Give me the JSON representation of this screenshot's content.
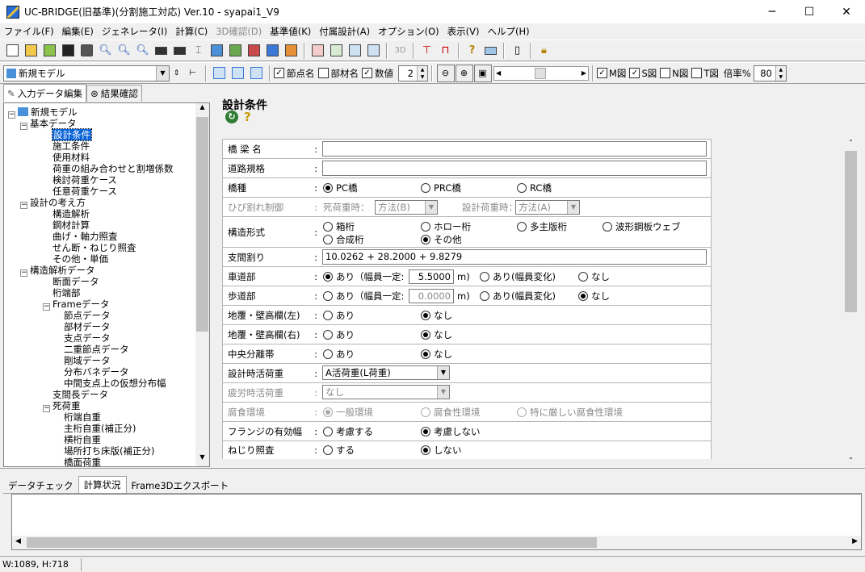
{
  "window": {
    "title": "UC-BRIDGE(旧基準)(分割施工対応) Ver.10 - syapai1_V9",
    "minimize": "─",
    "maximize": "☐",
    "close": "✕"
  },
  "menu": [
    {
      "label": "ファイル(F)"
    },
    {
      "label": "編集(E)"
    },
    {
      "label": "ジェネレータ(I)"
    },
    {
      "label": "計算(C)"
    },
    {
      "label": "3D確認(D)",
      "disabled": true
    },
    {
      "label": "基準値(K)"
    },
    {
      "label": "付属設計(A)"
    },
    {
      "label": "オプション(O)"
    },
    {
      "label": "表示(V)"
    },
    {
      "label": "ヘルプ(H)"
    }
  ],
  "toolbar2": {
    "model_select": "新規モデル",
    "nodename_label": "節点名",
    "membername_label": "部材名",
    "value_label": "数値",
    "digits_value": "2",
    "m_label": "M図",
    "s_label": "S図",
    "n_label": "N図",
    "t_label": "T図",
    "zoom_label": "倍率%",
    "zoom_value": "80"
  },
  "left_tabs": {
    "input": "入力データ編集",
    "result": "結果確認"
  },
  "tree": [
    {
      "label": "新規モデル",
      "level": 0,
      "box": "-"
    },
    {
      "label": "基本データ",
      "level": 1,
      "box": "-"
    },
    {
      "label": "設計条件",
      "level": 2,
      "selected": true
    },
    {
      "label": "施工条件",
      "level": 2
    },
    {
      "label": "使用材料",
      "level": 2
    },
    {
      "label": "荷重の組み合わせと割増係数",
      "level": 2
    },
    {
      "label": "検討荷重ケース",
      "level": 2
    },
    {
      "label": "任意荷重ケース",
      "level": 2
    },
    {
      "label": "設計の考え方",
      "level": 1,
      "box": "-"
    },
    {
      "label": "構造解析",
      "level": 2
    },
    {
      "label": "鋼材計算",
      "level": 2
    },
    {
      "label": "曲げ・軸力照査",
      "level": 2
    },
    {
      "label": "せん断・ねじり照査",
      "level": 2
    },
    {
      "label": "その他・単価",
      "level": 2
    },
    {
      "label": "構造解析データ",
      "level": 1,
      "box": "-"
    },
    {
      "label": "断面データ",
      "level": 2
    },
    {
      "label": "桁端部",
      "level": 2
    },
    {
      "label": "Frameデータ",
      "level": 2,
      "box": "-"
    },
    {
      "label": "節点データ",
      "level": 3
    },
    {
      "label": "部材データ",
      "level": 3
    },
    {
      "label": "支点データ",
      "level": 3
    },
    {
      "label": "二重節点データ",
      "level": 3
    },
    {
      "label": "剛域データ",
      "level": 3
    },
    {
      "label": "分布バネデータ",
      "level": 3
    },
    {
      "label": "中間支点上の仮想分布幅",
      "level": 3
    },
    {
      "label": "支間長データ",
      "level": 2
    },
    {
      "label": "死荷重",
      "level": 2,
      "box": "-"
    },
    {
      "label": "桁端自重",
      "level": 3
    },
    {
      "label": "主桁自重(補正分)",
      "level": 3
    },
    {
      "label": "横桁自重",
      "level": 3
    },
    {
      "label": "場所打ち床版(補正分)",
      "level": 3
    },
    {
      "label": "橋面荷重",
      "level": 3
    }
  ],
  "form": {
    "title": "設計条件",
    "colon": ":",
    "rows": {
      "bridge_name": {
        "label": "橋 梁 名",
        "value": ""
      },
      "road_class": {
        "label": "道路規格",
        "value": ""
      },
      "bridge_type": {
        "label": "橋種",
        "options": [
          "PC橋",
          "PRC橋",
          "RC橋"
        ]
      },
      "crack": {
        "label": "ひび割れ制御",
        "dead_label": "死荷重時：",
        "dead_value": "方法(B)",
        "design_label": "設計荷重時：",
        "design_value": "方法(A)"
      },
      "structure": {
        "label": "構造形式",
        "options": [
          "箱桁",
          "ホロー桁",
          "多主版桁",
          "波形鋼板ウェブ",
          "合成桁",
          "その他"
        ]
      },
      "span": {
        "label": "支間割り",
        "value": "10.0262 + 28.2000 + 9.8279"
      },
      "lane": {
        "label": "車道部",
        "opt1": "あり（幅員一定:",
        "value": "5.5000",
        "unit": "m)",
        "opt2": "あり(幅員変化)",
        "opt3": "なし"
      },
      "sidewalk": {
        "label": "歩道部",
        "opt1": "あり（幅員一定:",
        "value": "0.0000",
        "unit": "m)",
        "opt2": "あり(幅員変化)",
        "opt3": "なし"
      },
      "curb_left": {
        "label": "地覆・壁高欄(左)",
        "opt1": "あり",
        "opt2": "なし"
      },
      "curb_right": {
        "label": "地覆・壁高欄(右)",
        "opt1": "あり",
        "opt2": "なし"
      },
      "median": {
        "label": "中央分離帯",
        "opt1": "あり",
        "opt2": "なし"
      },
      "live_load": {
        "label": "設計時活荷重",
        "value": "A活荷重(L荷重)"
      },
      "fatigue": {
        "label": "疲労時活荷重",
        "value": "なし"
      },
      "corrosion": {
        "label": "腐食環境",
        "options": [
          "一般環境",
          "腐食性環境",
          "特に厳しい腐食性環境"
        ]
      },
      "flange": {
        "label": "フランジの有効幅",
        "opt1": "考慮する",
        "opt2": "考慮しない"
      },
      "torsion": {
        "label": "ねじり照査",
        "opt1": "する",
        "opt2": "しない"
      }
    }
  },
  "bottom_tabs": [
    "データチェック",
    "計算状況",
    "Frame3Dエクスポート"
  ],
  "status": {
    "text": "W:1089, H:718"
  }
}
